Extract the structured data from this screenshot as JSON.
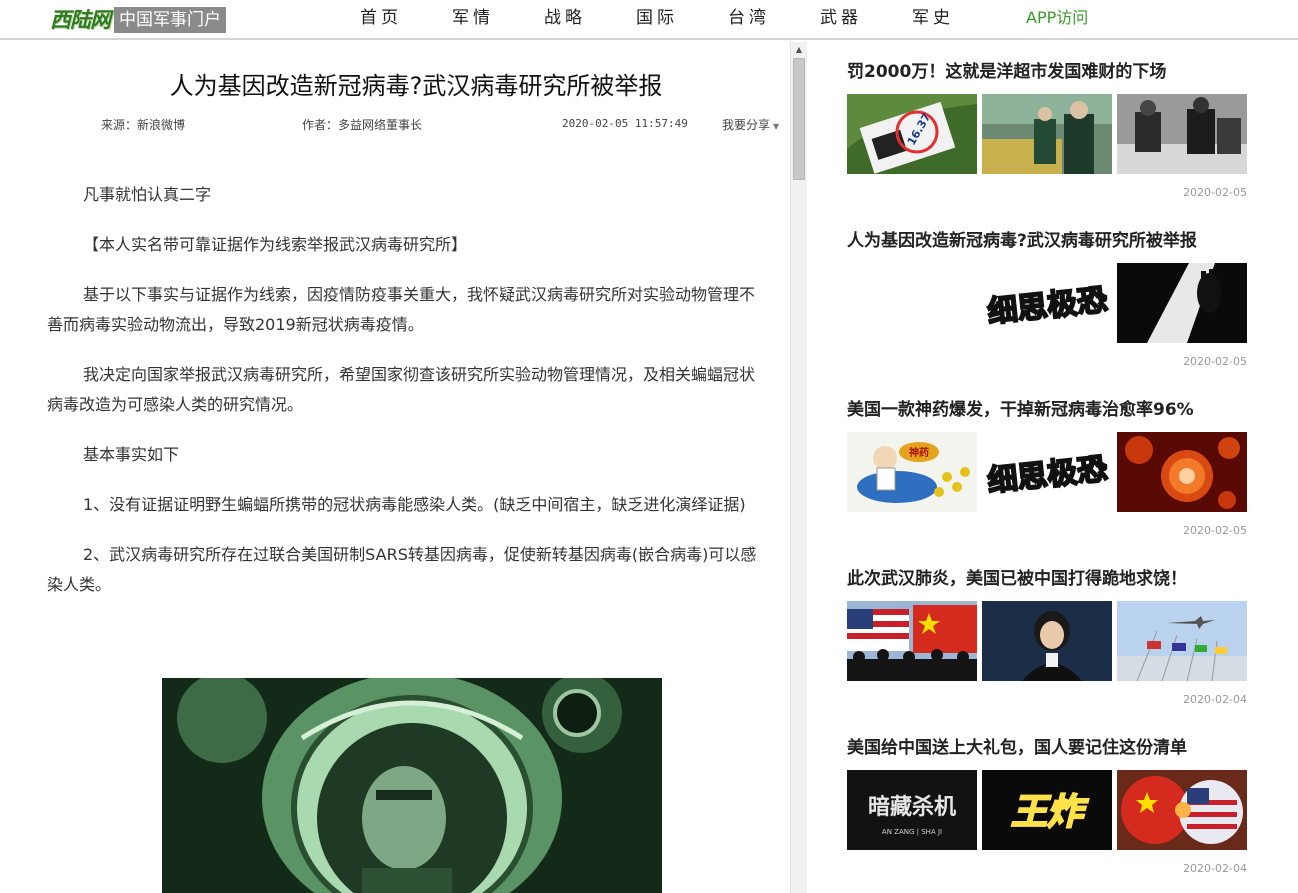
{
  "header": {
    "logo_mark": "西陆网",
    "logo_sub": "中国军事门户",
    "nav": [
      "首页",
      "军情",
      "战略",
      "国际",
      "台湾",
      "武器",
      "军史"
    ],
    "app": "APP访问"
  },
  "article": {
    "title": "人为基因改造新冠病毒?武汉病毒研究所被举报",
    "source": "来源：新浪微博",
    "author": "作者：多益网络董事长",
    "time": "2020-02-05 11:57:49",
    "share": "我要分享",
    "paragraphs": [
      "凡事就怕认真二字",
      "【本人实名带可靠证据作为线索举报武汉病毒研究所】",
      "基于以下事实与证据作为线索，因疫情防疫事关重大，我怀疑武汉病毒研究所对实验动物管理不善而病毒实验动物流出，导致2019新冠状病毒疫情。",
      "我决定向国家举报武汉病毒研究所，希望国家彻查该研究所实验动物管理情况，及相关蝙蝠冠状病毒改造为可感染人类的研究情况。",
      "基本事实如下",
      "1、没有证据证明野生蝙蝠所携带的冠状病毒能感染人类。(缺乏中间宿主，缺乏进化演绎证据)",
      "2、武汉病毒研究所存在过联合美国研制SARS转基因病毒，促使新转基因病毒(嵌合病毒)可以感染人类。"
    ]
  },
  "sidebar": {
    "items": [
      {
        "title": "罚2000万！这就是洋超市发国难财的下场",
        "date": "2020-02-05"
      },
      {
        "title": "人为基因改造新冠病毒?武汉病毒研究所被举报",
        "date": "2020-02-05"
      },
      {
        "title": "美国一款神药爆发，干掉新冠病毒治愈率96%",
        "date": "2020-02-05"
      },
      {
        "title": "此次武汉肺炎，美国已被中国打得跪地求饶！",
        "date": "2020-02-04"
      },
      {
        "title": "美国给中国送上大礼包，国人要记住这份清单",
        "date": "2020-02-04"
      }
    ],
    "thumb_texts": {
      "price_tag": "16.37",
      "xisi": "细思极恐",
      "shenyao": "神药",
      "anzang": "暗藏杀机",
      "anzang_pinyin": "AN ZANG | SHA JI",
      "wangzha": "王炸"
    }
  },
  "colors": {
    "brand_green": "#2f7a1f",
    "app_green": "#3a9a26",
    "date_gray": "#999999"
  }
}
